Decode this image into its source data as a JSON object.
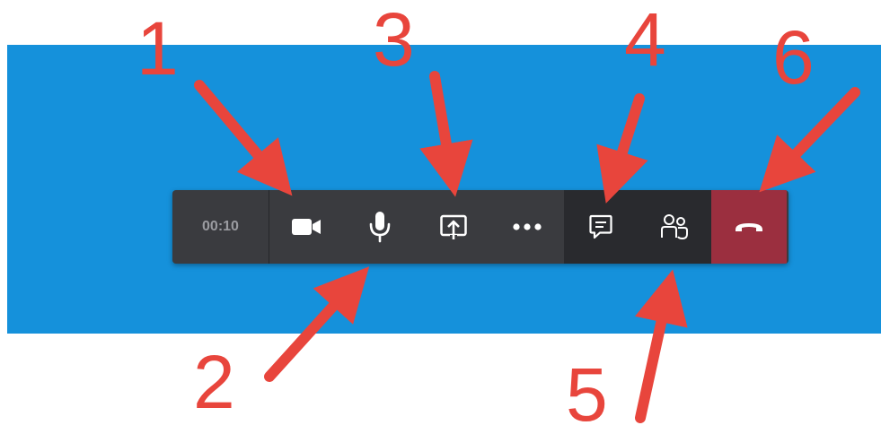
{
  "call_bar": {
    "timer": "00:10",
    "buttons": [
      {
        "name": "video",
        "icon": "video-camera-icon"
      },
      {
        "name": "microphone",
        "icon": "microphone-icon"
      },
      {
        "name": "share-screen",
        "icon": "share-screen-icon"
      },
      {
        "name": "more-options",
        "icon": "ellipsis-icon"
      },
      {
        "name": "chat",
        "icon": "chat-icon"
      },
      {
        "name": "participants",
        "icon": "participants-icon"
      },
      {
        "name": "hang-up",
        "icon": "phone-hangup-icon"
      }
    ]
  },
  "annotations": {
    "labels": [
      "1",
      "2",
      "3",
      "4",
      "5",
      "6"
    ],
    "color": "#e8453c"
  },
  "colors": {
    "background": "#1591db",
    "toolbar": "#3a3b3f",
    "toolbar_dark_section": "#292a2e",
    "hangup": "#9b2f3f",
    "timer_text": "#9a9ba0"
  }
}
